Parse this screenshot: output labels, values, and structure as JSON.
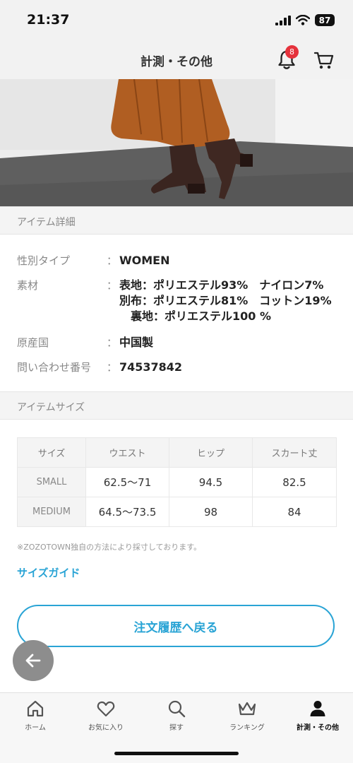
{
  "status_bar": {
    "time": "21:37",
    "battery": "87"
  },
  "nav": {
    "title": "計測・その他",
    "notification_count": "8"
  },
  "item_details": {
    "heading": "アイテム詳細",
    "gender_label": "性別タイプ",
    "gender_value": "WOMEN",
    "material_label": "素材",
    "material_line1": "表地：ポリエステル93%　ナイロン7%",
    "material_line2": "別布：ポリエステル81%　コットン19%",
    "material_line3": "裏地：ポリエステル100 %",
    "origin_label": "原産国",
    "origin_value": "中国製",
    "inquiry_label": "問い合わせ番号",
    "inquiry_value": "74537842",
    "colon": "："
  },
  "item_size": {
    "heading": "アイテムサイズ",
    "headers": [
      "サイズ",
      "ウエスト",
      "ヒップ",
      "スカート丈"
    ],
    "rows": [
      [
        "SMALL",
        "62.5〜71",
        "94.5",
        "82.5"
      ],
      [
        "MEDIUM",
        "64.5〜73.5",
        "98",
        "84"
      ]
    ],
    "note": "※ZOZOTOWN独自の方法により採寸しております。",
    "size_guide_label": "サイズガイド"
  },
  "return_button_label": "注文履歴へ戻る",
  "tab_bar": {
    "items": [
      {
        "label": "ホーム",
        "icon": "home-icon"
      },
      {
        "label": "お気に入り",
        "icon": "heart-icon"
      },
      {
        "label": "探す",
        "icon": "search-icon"
      },
      {
        "label": "ランキング",
        "icon": "crown-icon"
      },
      {
        "label": "計測・その他",
        "icon": "person-icon"
      }
    ],
    "active_index": 4
  },
  "colors": {
    "accent": "#2aa4d5",
    "badge": "#e5323c",
    "back_button": "#8d8d8d"
  }
}
